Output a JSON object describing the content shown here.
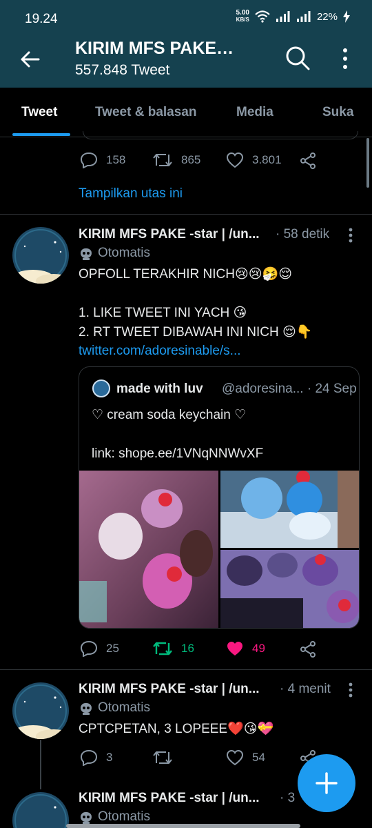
{
  "status_bar": {
    "time": "19.24",
    "net_speed_value": "5.00",
    "net_speed_unit": "KB/S",
    "battery": "22%"
  },
  "header": {
    "title": "KIRIM MFS PAKE…",
    "subtitle": "557.848 Tweet"
  },
  "tabs": [
    {
      "label": "Tweet",
      "active": true
    },
    {
      "label": "Tweet & balasan",
      "active": false
    },
    {
      "label": "Media",
      "active": false
    },
    {
      "label": "Suka",
      "active": false
    }
  ],
  "prev_tweet": {
    "replies": "158",
    "retweets": "865",
    "likes": "3.801",
    "show_thread": "Tampilkan utas ini"
  },
  "tweet1": {
    "name": "KIRIM MFS PAKE -star | /un...",
    "time": "· 58 detik",
    "badge": "Otomatis",
    "lines": [
      "OPFOLL TERAKHIR NICH😢😢🤧😌",
      "",
      "1. LIKE TWEET INI YACH 😘",
      "2. RT TWEET DIBAWAH INI NICH 😌👇"
    ],
    "link": "twitter.com/adoresinable/s...",
    "quote": {
      "name": "made with luv",
      "handle": "@adoresina... · 24 Sep",
      "lines": [
        "♡ cream soda keychain ♡",
        "",
        "link: shope.ee/1VNqNNWvXF"
      ]
    },
    "replies": "25",
    "retweets": "16",
    "likes": "49"
  },
  "tweet2": {
    "name": "KIRIM MFS PAKE -star | /un...",
    "time": "· 4 menit",
    "badge": "Otomatis",
    "text": "CPTCPETAN, 3 LOPEEE❤️😘💝",
    "replies": "3",
    "retweets": "",
    "likes": "54"
  },
  "tweet3": {
    "name": "KIRIM MFS PAKE -star | /un...",
    "time": "· 3",
    "badge": "Otomatis"
  },
  "colors": {
    "header_bg": "#15414f",
    "accent": "#1d9bf0",
    "retweet_active": "#00ba7c",
    "like_active": "#f91880"
  }
}
